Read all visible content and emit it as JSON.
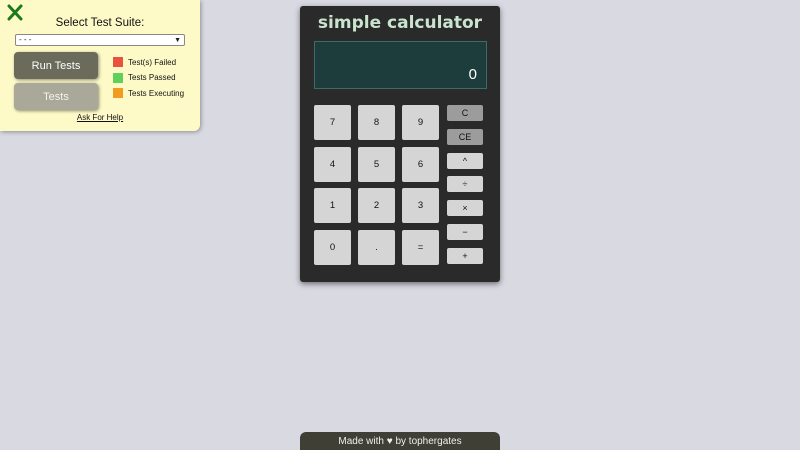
{
  "test_panel": {
    "close_icon": "close-x-icon",
    "title": "Select Test Suite:",
    "select_value": "- - -",
    "run_tests_label": "Run Tests",
    "tests_label": "Tests",
    "legend": [
      {
        "label": "Test(s) Failed",
        "color": "#e8533d"
      },
      {
        "label": "Tests Passed",
        "color": "#5fd15a"
      },
      {
        "label": "Tests Executing",
        "color": "#f29c1f"
      }
    ],
    "help_link": "Ask For Help"
  },
  "calculator": {
    "title": "simple calculator",
    "display": "0",
    "keys": [
      [
        "7",
        "8",
        "9"
      ],
      [
        "4",
        "5",
        "6"
      ],
      [
        "1",
        "2",
        "3"
      ],
      [
        "0",
        ".",
        "="
      ]
    ],
    "operators": [
      "C",
      "CE",
      "^",
      "÷",
      "×",
      "−",
      "+"
    ]
  },
  "footer": {
    "text": "Made with ♥ by tophergates"
  }
}
